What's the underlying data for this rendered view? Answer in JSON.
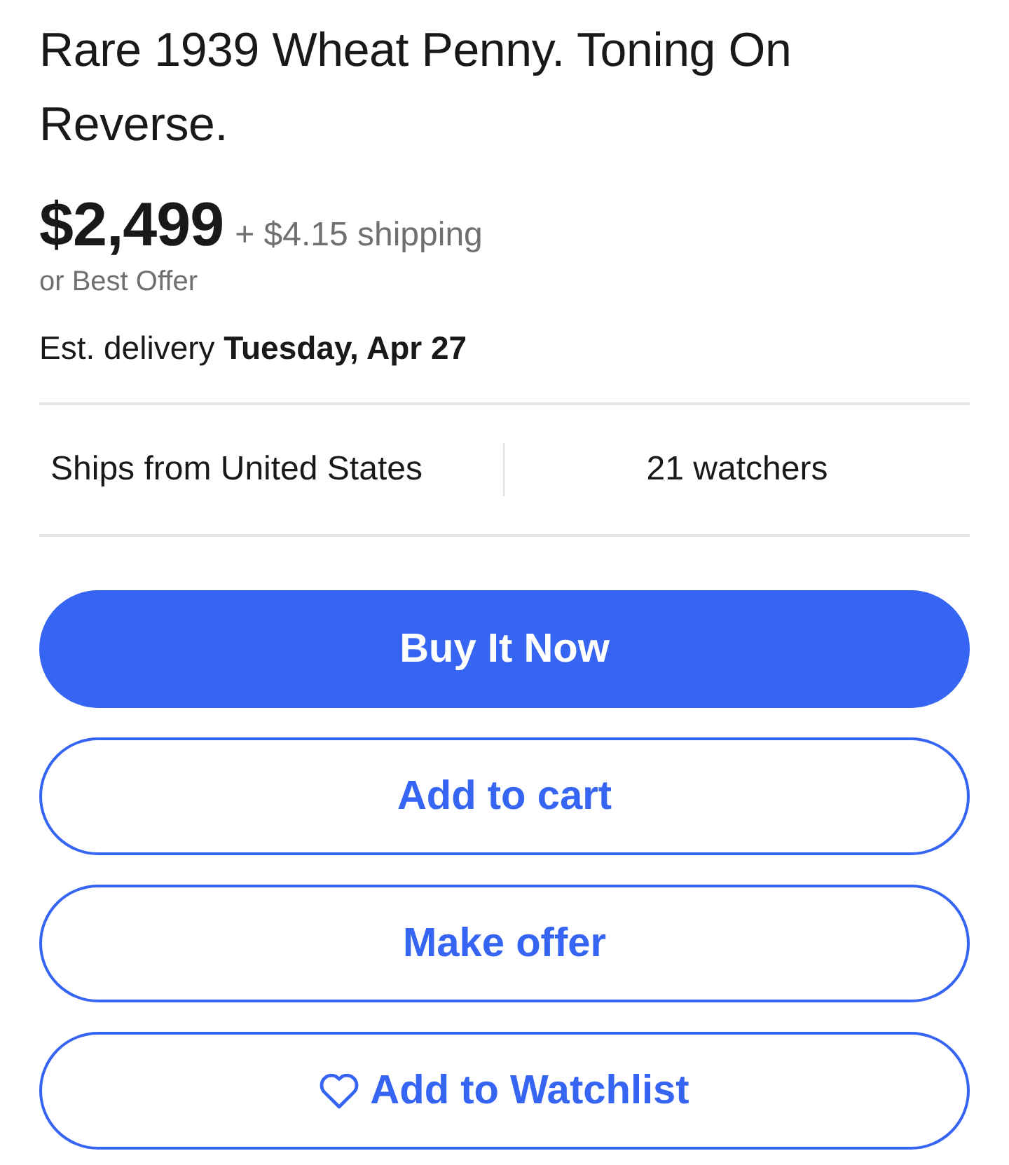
{
  "title": "Rare 1939 Wheat Penny. Toning On Reverse.",
  "price": {
    "amount": "$2,499",
    "shipping": "+ $4.15 shipping",
    "offer": "or Best Offer"
  },
  "delivery": "Est. delivery **Tuesday, Apr 27**",
  "info": [
    "Ships from United States",
    "21 watchers"
  ],
  "buttons": [
    {
      "label": "Buy It Now",
      "kind": "primary"
    },
    {
      "label": "Add to cart",
      "kind": "outline"
    },
    {
      "label": "Make offer",
      "kind": "outline"
    },
    {
      "label": "Add to Watchlist",
      "kind": "watch"
    }
  ]
}
